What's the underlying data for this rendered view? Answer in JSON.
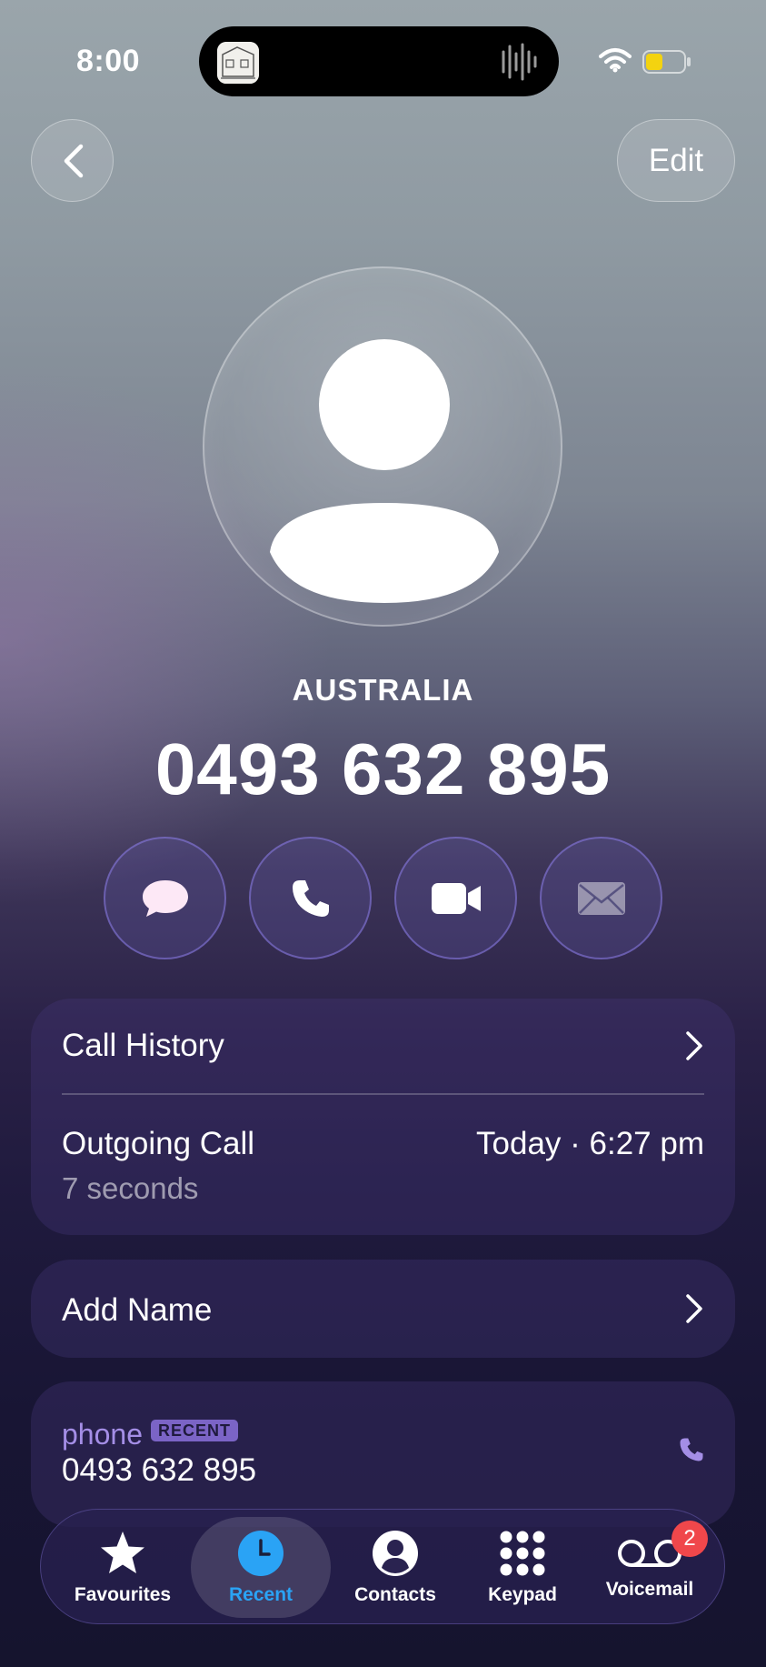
{
  "status_bar": {
    "time": "8:00"
  },
  "header": {
    "edit_label": "Edit"
  },
  "contact": {
    "country": "AUSTRALIA",
    "number": "0493 632 895"
  },
  "actions": [
    {
      "name": "message",
      "icon": "message-bubble-icon"
    },
    {
      "name": "call",
      "icon": "phone-icon"
    },
    {
      "name": "video",
      "icon": "video-camera-icon"
    },
    {
      "name": "mail",
      "icon": "mail-icon"
    }
  ],
  "call_history": {
    "title": "Call History",
    "entry_type": "Outgoing Call",
    "entry_time": "Today · 6:27 pm",
    "entry_duration": "7 seconds"
  },
  "add_name": {
    "label": "Add Name"
  },
  "phone_entry": {
    "label": "phone",
    "badge": "RECENT",
    "number": "0493 632 895"
  },
  "tabs": [
    {
      "label": "Favourites",
      "icon": "star-icon"
    },
    {
      "label": "Recent",
      "icon": "clock-icon",
      "active": true
    },
    {
      "label": "Contacts",
      "icon": "person-circle-icon"
    },
    {
      "label": "Keypad",
      "icon": "keypad-icon"
    },
    {
      "label": "Voicemail",
      "icon": "voicemail-icon",
      "badge": "2"
    }
  ],
  "colors": {
    "accent_purple": "#a48ee6",
    "active_tab": "#2aa3f5",
    "badge_red": "#f0474b"
  }
}
